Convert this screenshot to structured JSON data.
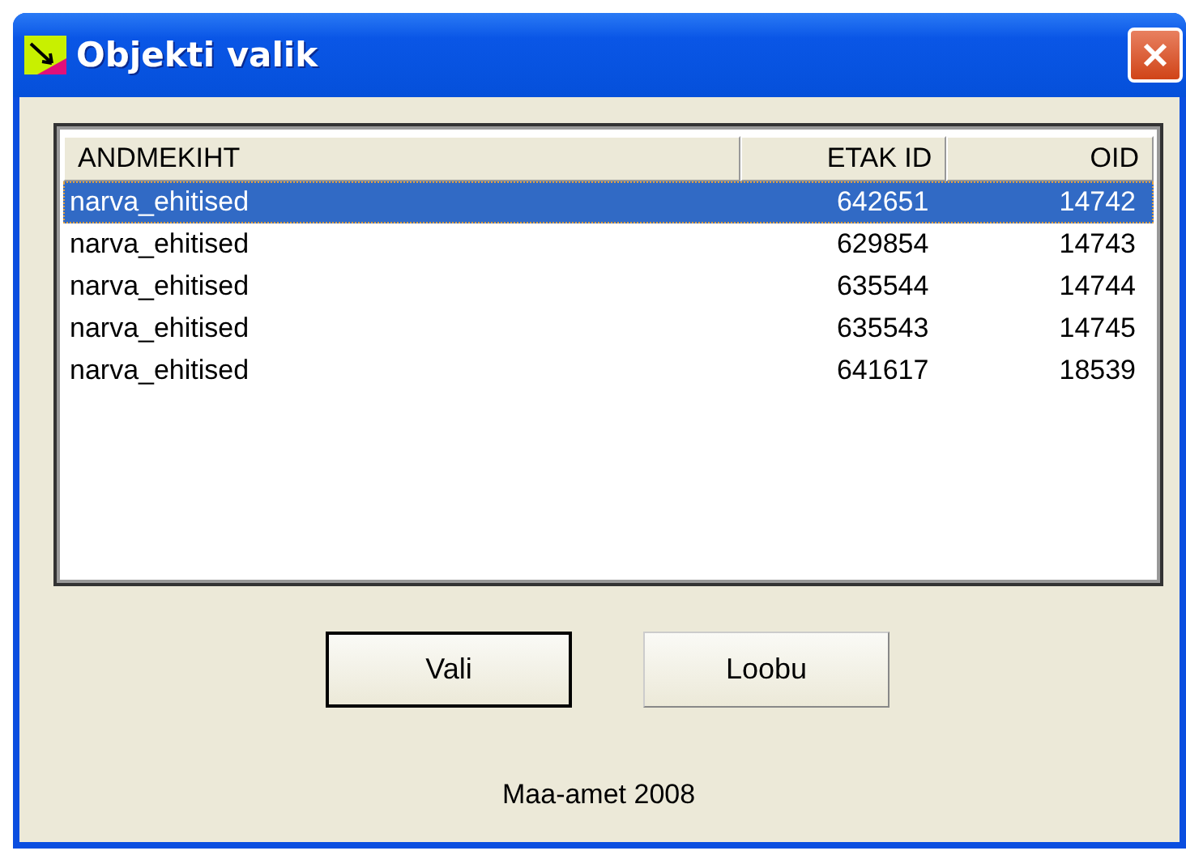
{
  "window": {
    "title": "Objekti valik"
  },
  "table": {
    "columns": [
      "ANDMEKIHT",
      "ETAK ID",
      "OID"
    ],
    "rows": [
      {
        "cells": [
          "narva_ehitised",
          "642651",
          "14742"
        ],
        "selected": true
      },
      {
        "cells": [
          "narva_ehitised",
          "629854",
          "14743"
        ],
        "selected": false
      },
      {
        "cells": [
          "narva_ehitised",
          "635544",
          "14744"
        ],
        "selected": false
      },
      {
        "cells": [
          "narva_ehitised",
          "635543",
          "14745"
        ],
        "selected": false
      },
      {
        "cells": [
          "narva_ehitised",
          "641617",
          "18539"
        ],
        "selected": false
      }
    ]
  },
  "buttons": [
    {
      "label": "Vali",
      "default": true
    },
    {
      "label": "Loobu",
      "default": false
    }
  ],
  "footer": "Maa-amet 2008"
}
